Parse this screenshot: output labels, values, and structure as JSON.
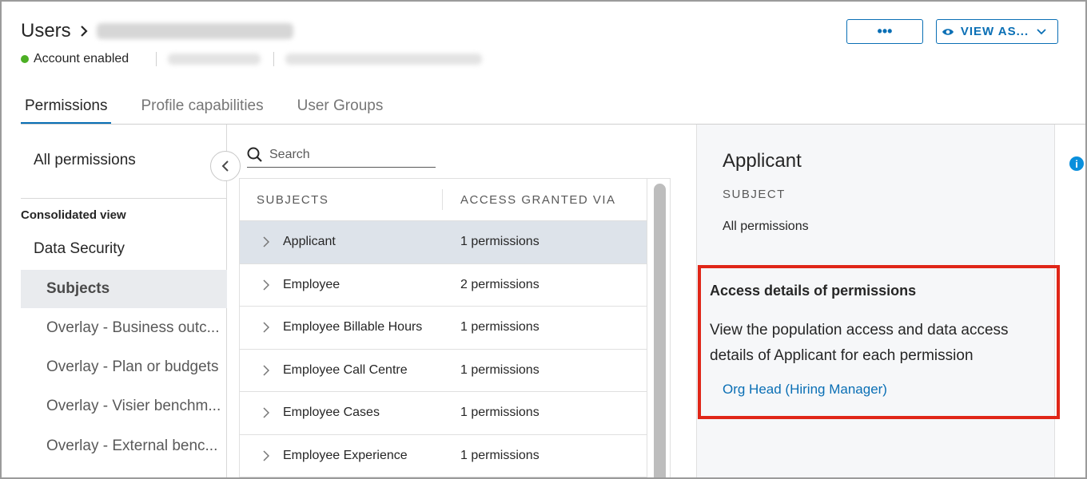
{
  "header": {
    "title": "Users",
    "status": "Account enabled",
    "more_label": "•••",
    "view_as_label": "VIEW AS..."
  },
  "tabs": [
    {
      "label": "Permissions",
      "active": true
    },
    {
      "label": "Profile capabilities",
      "active": false
    },
    {
      "label": "User Groups",
      "active": false
    }
  ],
  "sidebar": {
    "all_permissions": "All permissions",
    "consolidated_view": "Consolidated view",
    "data_security": "Data Security",
    "items": [
      {
        "label": "Subjects",
        "selected": true
      },
      {
        "label": "Overlay - Business outc..."
      },
      {
        "label": "Overlay - Plan or budgets"
      },
      {
        "label": "Overlay - Visier benchm..."
      },
      {
        "label": "Overlay - External benc..."
      }
    ]
  },
  "search": {
    "placeholder": "Search"
  },
  "table": {
    "columns": [
      "SUBJECTS",
      "ACCESS GRANTED VIA"
    ],
    "rows": [
      {
        "subject": "Applicant",
        "access": "1 permissions"
      },
      {
        "subject": "Employee",
        "access": "2 permissions"
      },
      {
        "subject": "Employee Billable Hours",
        "access": "1 permissions"
      },
      {
        "subject": "Employee Call Centre",
        "access": "1 permissions"
      },
      {
        "subject": "Employee Cases",
        "access": "1 permissions"
      },
      {
        "subject": "Employee Experience",
        "access": "1 permissions"
      }
    ]
  },
  "detail": {
    "title": "Applicant",
    "subtitle": "SUBJECT",
    "all_permissions": "All permissions",
    "access_title": "Access details of permissions",
    "access_desc": "View the population access and data access details of Applicant for each permission",
    "link": "Org Head (Hiring Manager)"
  },
  "colors": {
    "accent": "#0a6fb5",
    "status_green": "#4caf24",
    "highlight_red": "#e02618",
    "selected_row": "#dde3ea"
  },
  "icons": [
    "chevron-right-icon",
    "more-icon",
    "eye-icon",
    "chevron-down-icon",
    "chevron-left-icon",
    "search-icon",
    "info-icon"
  ]
}
